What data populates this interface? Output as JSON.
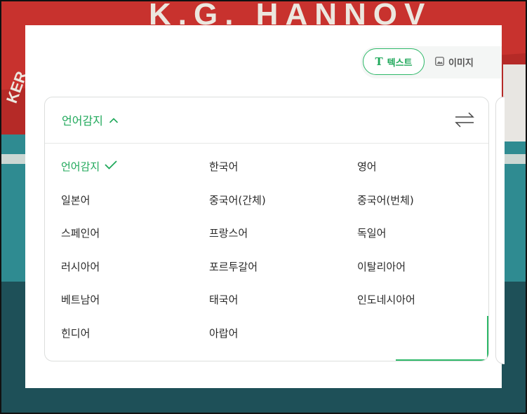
{
  "backdrop": {
    "text": "K.G. HANNOV",
    "side_text": "KER"
  },
  "mode_tabs": {
    "text_label": "텍스트",
    "image_label": "이미지"
  },
  "source_language": {
    "label": "언어감지"
  },
  "languages": [
    {
      "label": "언어감지",
      "selected": true
    },
    {
      "label": "한국어",
      "selected": false
    },
    {
      "label": "영어",
      "selected": false
    },
    {
      "label": "일본어",
      "selected": false
    },
    {
      "label": "중국어(간체)",
      "selected": false
    },
    {
      "label": "중국어(번체)",
      "selected": false
    },
    {
      "label": "스페인어",
      "selected": false
    },
    {
      "label": "프랑스어",
      "selected": false
    },
    {
      "label": "독일어",
      "selected": false
    },
    {
      "label": "러시아어",
      "selected": false
    },
    {
      "label": "포르투갈어",
      "selected": false
    },
    {
      "label": "이탈리아어",
      "selected": false
    },
    {
      "label": "베트남어",
      "selected": false
    },
    {
      "label": "태국어",
      "selected": false
    },
    {
      "label": "인도네시아어",
      "selected": false
    },
    {
      "label": "힌디어",
      "selected": false
    },
    {
      "label": "아랍어",
      "selected": false
    }
  ],
  "colors": {
    "accent": "#1fa85a",
    "border": "#dcdedd",
    "text": "#2a2a2a"
  }
}
